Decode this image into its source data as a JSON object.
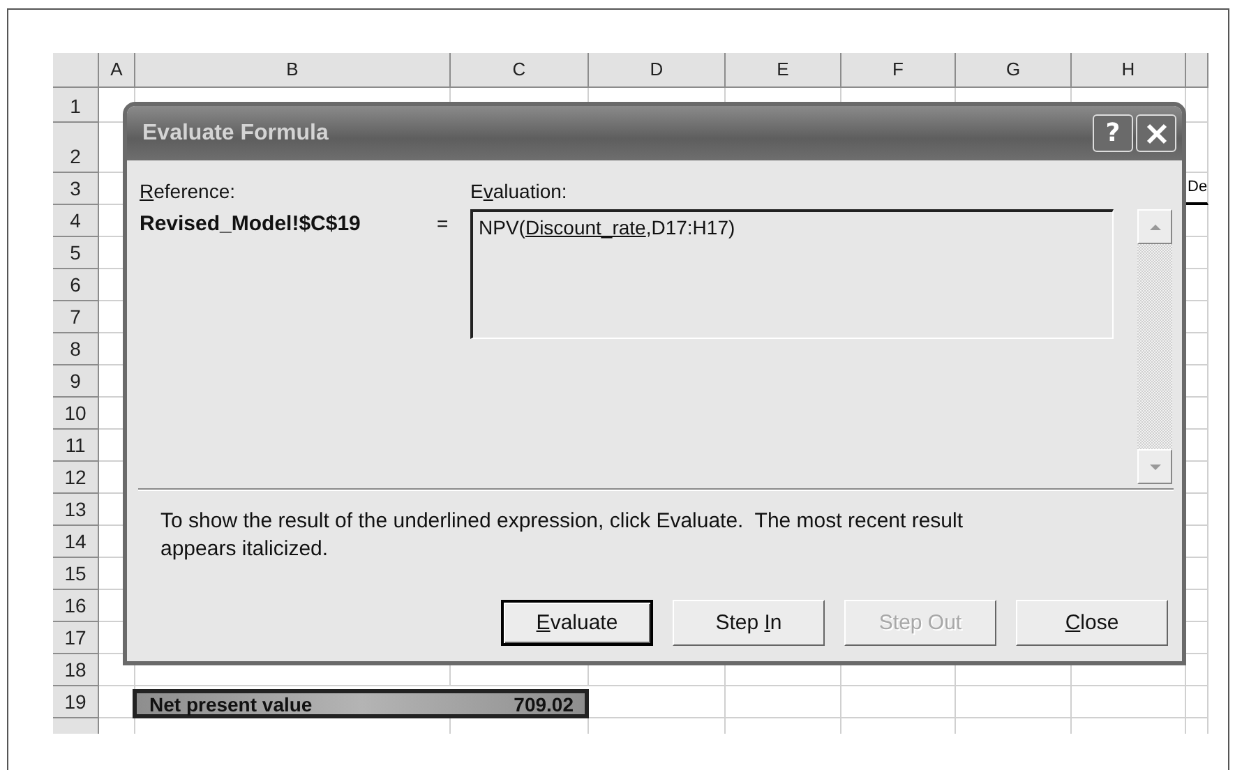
{
  "sheet": {
    "columns": [
      "A",
      "B",
      "C",
      "D",
      "E",
      "F",
      "G",
      "H"
    ],
    "rows": [
      "1",
      "2",
      "3",
      "4",
      "5",
      "6",
      "7",
      "8",
      "9",
      "10",
      "11",
      "12",
      "13",
      "14",
      "15",
      "16",
      "17",
      "18",
      "19"
    ],
    "cell_fragment": {
      "text": "De"
    },
    "summary": {
      "label": "Net present value",
      "value": "709.02"
    }
  },
  "dialog": {
    "title": "Evaluate Formula",
    "help_button": "?",
    "reference": {
      "label": [
        {
          "text": "R",
          "underline": true
        },
        {
          "text": "eference:",
          "underline": false
        }
      ],
      "value": "Revised_Model!$C$19"
    },
    "equals": "=",
    "evaluation": {
      "label": [
        {
          "text": "E",
          "underline": false
        },
        {
          "text": "v",
          "underline": true
        },
        {
          "text": "aluation:",
          "underline": false
        }
      ],
      "formula": [
        {
          "text": "NPV(",
          "underline": false
        },
        {
          "text": "Discount_rate",
          "underline": true
        },
        {
          "text": ",D17:H17)",
          "underline": false
        }
      ]
    },
    "message": "To show the result of the underlined expression, click Evaluate.  The most recent result appears italicized.",
    "buttons": [
      {
        "label": [
          {
            "text": "E",
            "underline": true
          },
          {
            "text": "valuate",
            "underline": false
          }
        ],
        "disabled": false,
        "default": true
      },
      {
        "label": [
          {
            "text": "Step ",
            "underline": false
          },
          {
            "text": "I",
            "underline": true
          },
          {
            "text": "n",
            "underline": false
          }
        ],
        "disabled": false,
        "default": false
      },
      {
        "label": [
          {
            "text": "Step Out",
            "underline": false
          }
        ],
        "disabled": true,
        "default": false
      },
      {
        "label": [
          {
            "text": "C",
            "underline": true
          },
          {
            "text": "lose",
            "underline": false
          }
        ],
        "disabled": false,
        "default": false
      }
    ]
  }
}
